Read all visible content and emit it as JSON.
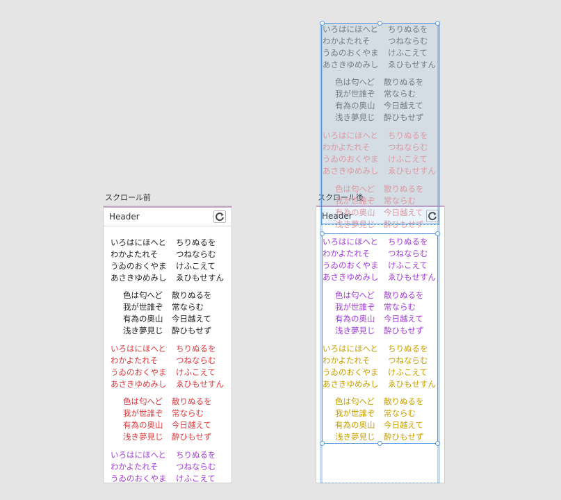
{
  "before_label": "スクロール前",
  "after_label": "スクロール後",
  "header_title": "Header",
  "poem_a": [
    [
      "いろはにほへと",
      "ちりぬるを"
    ],
    [
      "わかよたれそ",
      "つねならむ"
    ],
    [
      "うゐのおくやま",
      "けふこえて"
    ],
    [
      "あさきゆめみし",
      "ゑひもせすん"
    ]
  ],
  "poem_b": [
    [
      "色は匂へど",
      "散りぬるを"
    ],
    [
      "我が世誰ぞ",
      "常ならむ"
    ],
    [
      "有為の奥山",
      "今日越えて"
    ],
    [
      "浅き夢見じ",
      "酔ひもせず"
    ]
  ],
  "colors": {
    "black": "#222222",
    "red": "#e0393e",
    "purple": "#a23de0",
    "yellow": "#c9a000"
  }
}
